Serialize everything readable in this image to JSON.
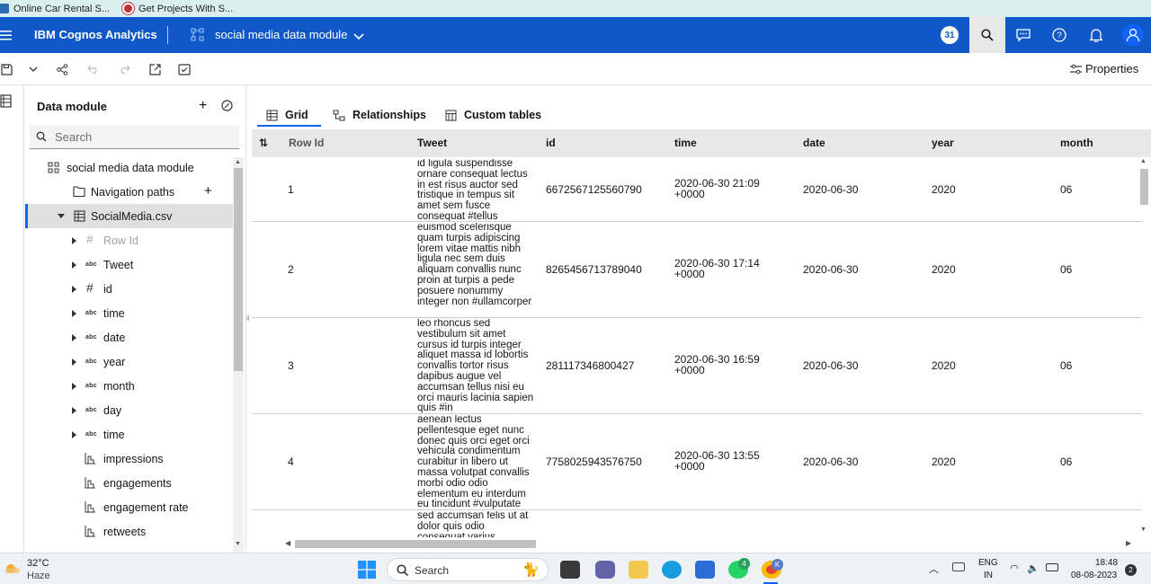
{
  "bookmarks": [
    {
      "label": "Online Car Rental S...",
      "icon": "car-icon"
    },
    {
      "label": "Get Projects With S...",
      "icon": "project-icon"
    }
  ],
  "header": {
    "brand": "IBM Cognos Analytics",
    "module_name": "social media data module",
    "badge": "31",
    "accent": "#0f62fe"
  },
  "toolbar": {
    "properties_label": "Properties"
  },
  "panel": {
    "title": "Data module",
    "search_placeholder": "Search",
    "tree": {
      "module": "social media data module",
      "navigation_paths": "Navigation paths",
      "table": "SocialMedia.csv",
      "columns": [
        {
          "label": "Row Id",
          "type": "#",
          "dimmed": true
        },
        {
          "label": "Tweet",
          "type": "abc"
        },
        {
          "label": "id",
          "type": "#"
        },
        {
          "label": "time",
          "type": "abc"
        },
        {
          "label": "date",
          "type": "abc"
        },
        {
          "label": "year",
          "type": "abc"
        },
        {
          "label": "month",
          "type": "abc"
        },
        {
          "label": "day",
          "type": "abc"
        },
        {
          "label": "time",
          "type": "abc"
        }
      ],
      "measures": [
        "impressions",
        "engagements",
        "engagement rate",
        "retweets"
      ]
    }
  },
  "tabs": [
    {
      "label": "Grid",
      "active": true
    },
    {
      "label": "Relationships",
      "active": false
    },
    {
      "label": "Custom tables",
      "active": false
    }
  ],
  "grid": {
    "columns": [
      "Row Id",
      "Tweet",
      "id",
      "time",
      "date",
      "year",
      "month"
    ],
    "rows": [
      {
        "row_id": "1",
        "tweet": "id ligula suspendisse ornare consequat lectus in est risus auctor sed tristique in tempus sit amet sem fusce consequat #tellus",
        "id": "6672567125560790",
        "time": "2020-06-30 21:09 +0000",
        "date": "2020-06-30",
        "year": "2020",
        "month": "06"
      },
      {
        "row_id": "2",
        "tweet": "euismod scelerisque quam turpis adipiscing lorem vitae mattis nibh ligula nec sem duis aliquam convallis nunc proin at turpis a pede posuere nonummy integer non #ullamcorper",
        "id": "8265456713789040",
        "time": "2020-06-30 17:14 +0000",
        "date": "2020-06-30",
        "year": "2020",
        "month": "06"
      },
      {
        "row_id": "3",
        "tweet": "leo rhoncus sed vestibulum sit amet cursus id turpis integer aliquet massa id lobortis convallis tortor risus dapibus augue vel accumsan tellus nisi eu orci mauris lacinia sapien quis #in",
        "id": "281117346800427",
        "time": "2020-06-30 16:59 +0000",
        "date": "2020-06-30",
        "year": "2020",
        "month": "06"
      },
      {
        "row_id": "4",
        "tweet": "aenean lectus pellentesque eget nunc donec quis orci eget orci vehicula condimentum curabitur in libero ut massa volutpat convallis morbi odio odio elementum eu interdum eu tincidunt #vulputate",
        "id": "7758025943576750",
        "time": "2020-06-30 13:55 +0000",
        "date": "2020-06-30",
        "year": "2020",
        "month": "06"
      },
      {
        "row_id": "",
        "tweet": "sed accumsan felis ut at dolor quis odio consequat varius",
        "id": "",
        "time": "",
        "date": "",
        "year": "",
        "month": ""
      }
    ]
  },
  "taskbar": {
    "weather_temp": "32°C",
    "weather_desc": "Haze",
    "search_label": "Search",
    "whatsapp_badge": "4",
    "lang": "ENG",
    "region": "IN",
    "clock_time": "18:48",
    "clock_date": "08-08-2023",
    "notification_count": "2"
  }
}
